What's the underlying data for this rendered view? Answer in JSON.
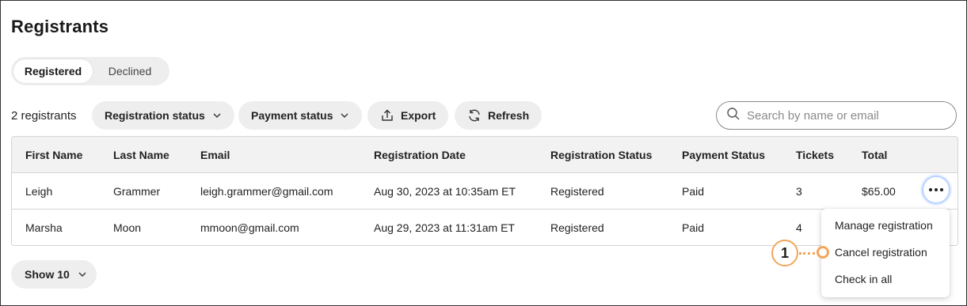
{
  "page": {
    "title": "Registrants"
  },
  "tabs": [
    {
      "label": "Registered",
      "active": true
    },
    {
      "label": "Declined",
      "active": false
    }
  ],
  "toolbar": {
    "count_label": "2 registrants",
    "registration_status_label": "Registration status",
    "payment_status_label": "Payment status",
    "export_label": "Export",
    "refresh_label": "Refresh",
    "search_placeholder": "Search by name or email"
  },
  "table": {
    "columns": [
      "First Name",
      "Last Name",
      "Email",
      "Registration Date",
      "Registration Status",
      "Payment Status",
      "Tickets",
      "Total"
    ],
    "rows": [
      [
        "Leigh",
        "Grammer",
        "leigh.grammer@gmail.com",
        "Aug 30, 2023 at 10:35am ET",
        "Registered",
        "Paid",
        "3",
        "$65.00"
      ],
      [
        "Marsha",
        "Moon",
        "mmoon@gmail.com",
        "Aug 29, 2023 at 11:31am ET",
        "Registered",
        "Paid",
        "4",
        ""
      ]
    ]
  },
  "row_menu": {
    "items": [
      "Manage registration",
      "Cancel registration",
      "Check in all"
    ]
  },
  "callout": {
    "number": "1"
  },
  "pagination": {
    "show_label": "Show 10"
  },
  "colors": {
    "accent_orange": "#f2a65a",
    "focus_blue": "#b9d2ff",
    "pill_bg": "#eeeeee"
  },
  "icons": [
    "chevron-down-icon",
    "export-icon",
    "refresh-icon",
    "search-icon",
    "more-horizontal-icon"
  ]
}
